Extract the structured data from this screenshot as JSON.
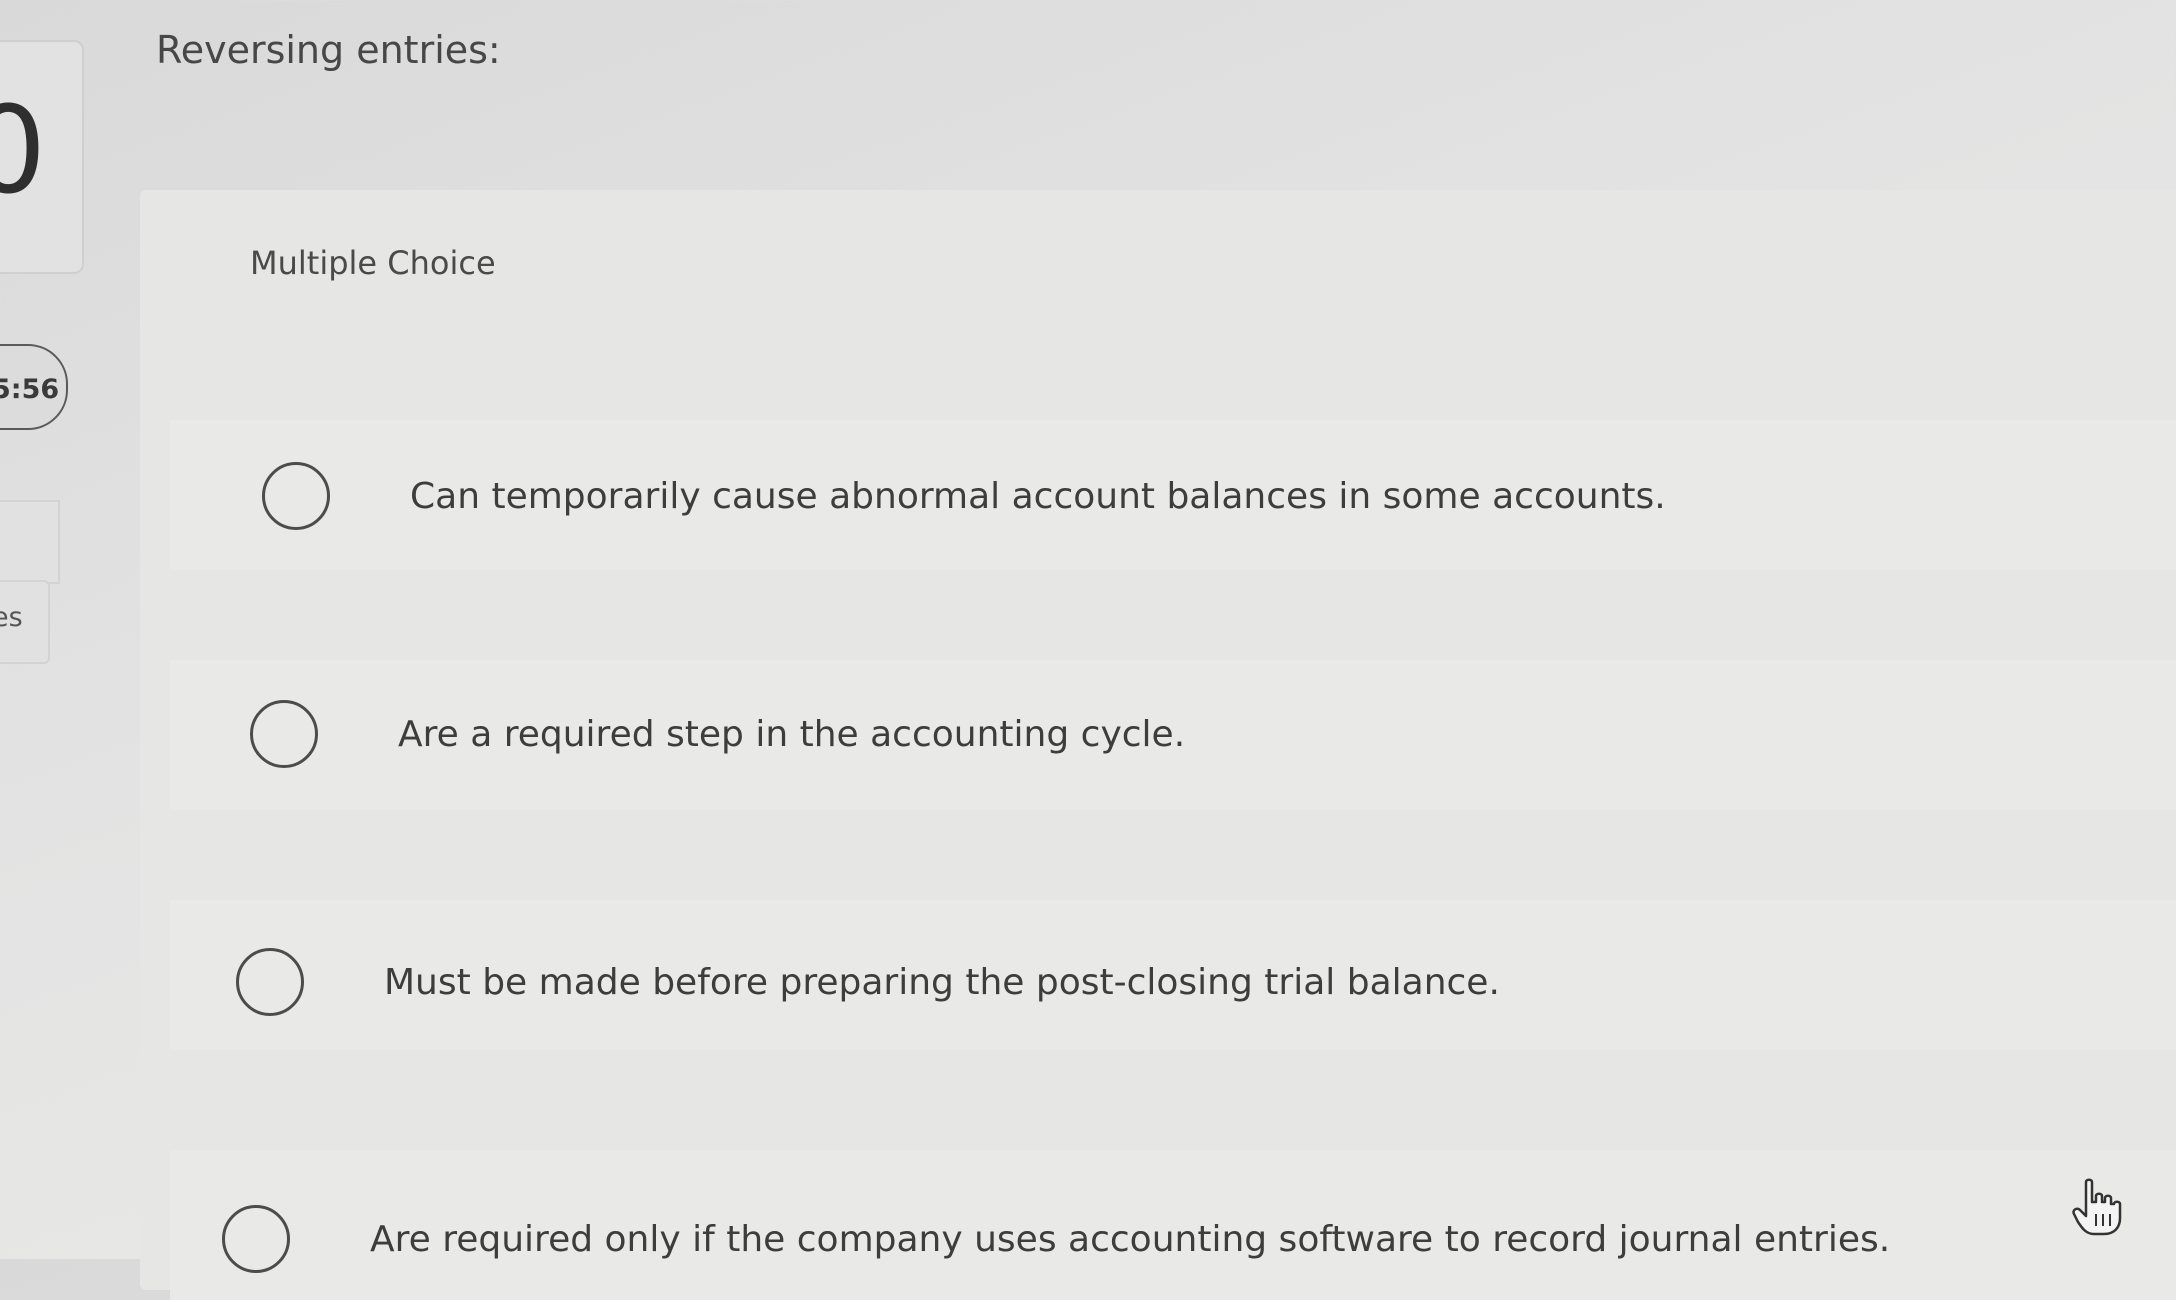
{
  "sidebar": {
    "digit": "0",
    "timer": "5:56",
    "label": "es"
  },
  "question": {
    "text": "Reversing entries:"
  },
  "question_type": "Multiple Choice",
  "options": [
    {
      "label": "Can temporarily cause abnormal account balances in some accounts."
    },
    {
      "label": "Are a required step in the accounting cycle."
    },
    {
      "label": "Must be made before preparing the post-closing trial balance."
    },
    {
      "label": "Are required only if the company uses accounting software to record journal entries."
    }
  ],
  "icons": {
    "cursor": "hand-pointer-icon"
  }
}
